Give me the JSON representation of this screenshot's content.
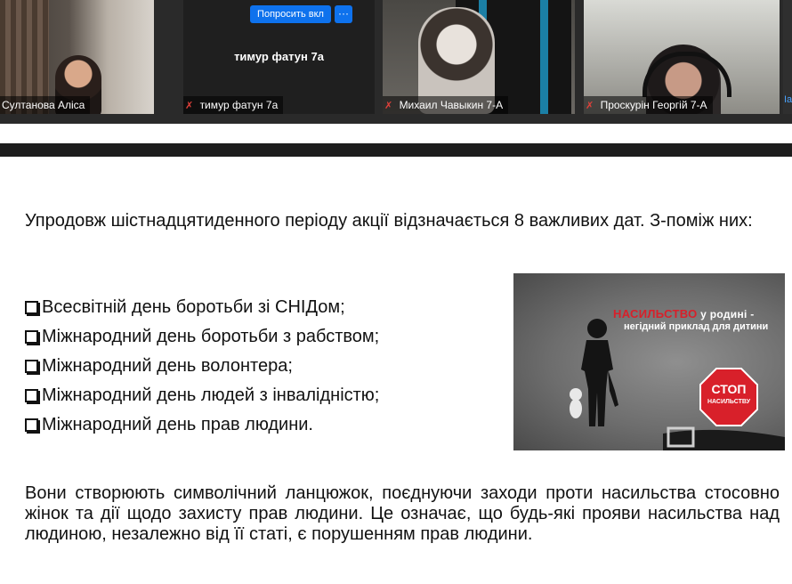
{
  "participants": [
    {
      "name": "Султанова Аліса",
      "muted": false
    },
    {
      "name": "тимур фатун 7а",
      "muted": true,
      "video_off": true
    },
    {
      "name": "Михаил Чавыкин 7-А",
      "muted": true
    },
    {
      "name": "Проскурін Георгій 7-А",
      "muted": true
    },
    {
      "name": "Ia",
      "muted": false
    }
  ],
  "tile_center_name": "тимур фатун 7а",
  "ask_button_label": "Попросить вкл",
  "more_button_label": "···",
  "slide": {
    "intro": "Упродовж шістнадцятиденного періоду акції відзначається 8 важливих дат. З-поміж них:",
    "bullets": [
      "Всесвітній день боротьби зі СНІДом;",
      "Міжнародний день боротьби з рабством;",
      "Міжнародний день волонтера;",
      "Міжнародний день людей з інвалідністю;",
      "Міжнародний день прав людини."
    ],
    "conclusion": "Вони створюють символічний ланцюжок, поєднуючи заходи проти насильства стосовно жінок та дії щодо захисту прав людини. Це означає, що будь-які прояви насильства над людиною, незалежно від її статі, є порушенням прав людини."
  },
  "poster": {
    "title_red": "НАСИЛЬСТВО",
    "title_rest": " у родині -",
    "subtitle": "негідний приклад для дитини",
    "stop_word": "СТОП",
    "stop_sub": "НАСИЛЬСТВУ"
  },
  "colors": {
    "accent_blue": "#0e72ed",
    "mute_red": "#e0403a",
    "stop_red": "#d8202a"
  },
  "icons": [
    "muted-mic-icon",
    "checkbox-icon",
    "stop-sign-icon"
  ]
}
